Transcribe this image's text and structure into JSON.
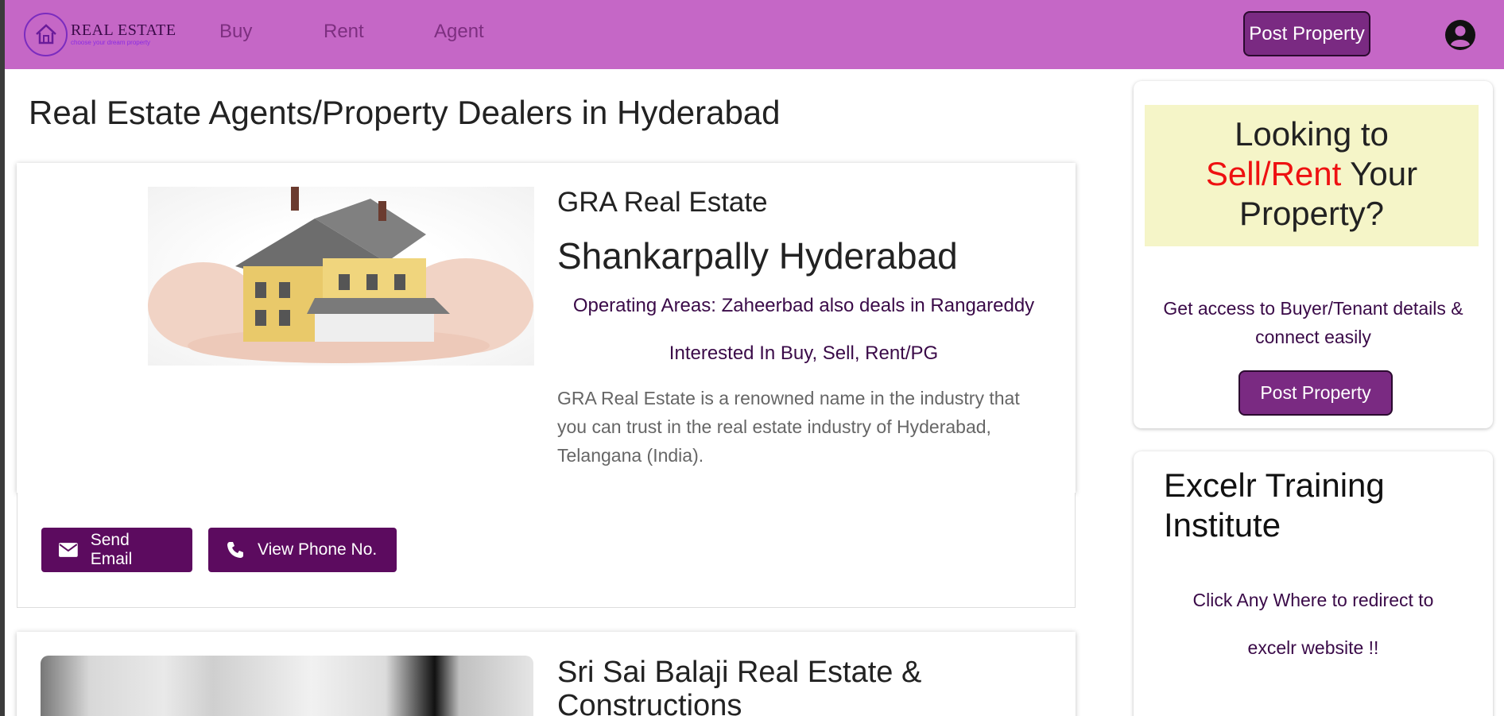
{
  "navbar": {
    "logo_title": "REAL ESTATE",
    "logo_tagline": "choose your dream property",
    "links": [
      "Buy",
      "Rent",
      "Agent"
    ],
    "post_property_label": "Post Property",
    "user_icon": "user-circle-icon",
    "bg_color": "#c567c6"
  },
  "page": {
    "title": "Real Estate Agents/Property Dealers in Hyderabad"
  },
  "listings": [
    {
      "name": "GRA Real Estate",
      "location": "Shankarpally Hyderabad",
      "operating_areas": "Operating Areas: Zaheerbad also deals in Rangareddy",
      "interested_in": "Interested In Buy, Sell, Rent/PG",
      "description": "GRA Real Estate is a renowned name in the industry that you can trust in the real estate industry of Hyderabad, Telangana (India).",
      "send_email_label": "Send Email",
      "view_phone_label": "View Phone No."
    },
    {
      "name": "Sri Sai Balaji Real Estate & Constructions"
    }
  ],
  "sidebar": {
    "promo_line1": "Looking to",
    "promo_highlight": "Sell/Rent",
    "promo_line2": "Your",
    "promo_line3": "Property?",
    "access_text": "Get access to Buyer/Tenant details & connect easily",
    "post_property_label": "Post Property",
    "ad_title": "Excelr Training Institute",
    "ad_line1": "Click Any Where to redirect to",
    "ad_line2": "excelr website !!"
  },
  "colors": {
    "accent": "#7a2a82",
    "button_dark": "#5c0b5f",
    "promo_bg": "#f5f5c8",
    "highlight_red": "#ee1111"
  }
}
